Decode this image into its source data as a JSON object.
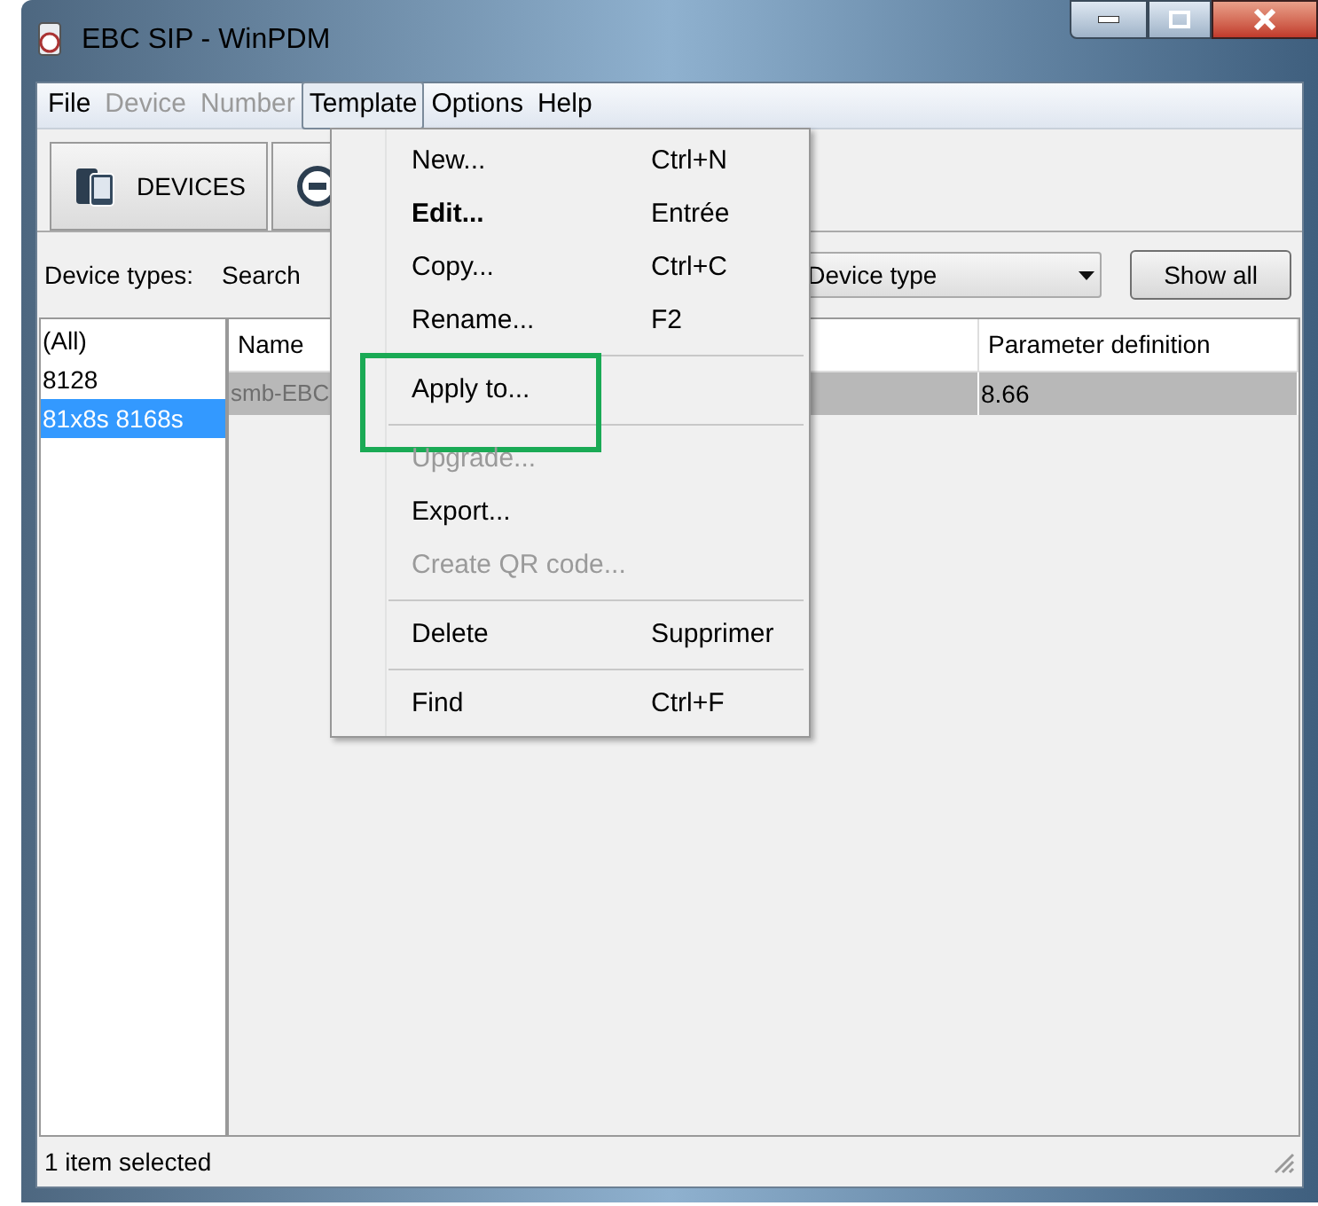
{
  "window": {
    "title": "EBC SIP - WinPDM"
  },
  "menubar": [
    {
      "label": "File",
      "disabled": false,
      "selected": false
    },
    {
      "label": "Device",
      "disabled": true,
      "selected": false
    },
    {
      "label": "Number",
      "disabled": true,
      "selected": false
    },
    {
      "label": "Template",
      "disabled": false,
      "selected": true
    },
    {
      "label": "Options",
      "disabled": false,
      "selected": false
    },
    {
      "label": "Help",
      "disabled": false,
      "selected": false
    }
  ],
  "tabs": [
    {
      "label": "DEVICES",
      "kind": "devices"
    },
    {
      "kind": "numbers"
    }
  ],
  "filter": {
    "label": "Device types:",
    "search_label": "Search",
    "dropdown": "Device type",
    "button": "Show all"
  },
  "device_types": [
    {
      "label": "(All)",
      "selected": false
    },
    {
      "label": "8128",
      "selected": false
    },
    {
      "label": "81x8s 8168s",
      "selected": true
    }
  ],
  "table": {
    "columns": [
      "Name",
      "Parameter definition"
    ],
    "rows": [
      {
        "cells": [
          "smb-EBC",
          "8.66"
        ],
        "selected": true
      }
    ]
  },
  "menu": [
    {
      "kind": "item",
      "label": "New...",
      "shortcut": "Ctrl+N",
      "bold": false,
      "disabled": false,
      "highlighted": false
    },
    {
      "kind": "item",
      "label": "Edit...",
      "shortcut": "Entrée",
      "bold": true,
      "disabled": false,
      "highlighted": false
    },
    {
      "kind": "item",
      "label": "Copy...",
      "shortcut": "Ctrl+C",
      "bold": false,
      "disabled": false,
      "highlighted": false
    },
    {
      "kind": "item",
      "label": "Rename...",
      "shortcut": "F2",
      "bold": false,
      "disabled": false,
      "highlighted": false
    },
    {
      "kind": "separator"
    },
    {
      "kind": "item",
      "label": "Apply to...",
      "bold": false,
      "disabled": false,
      "highlighted": true
    },
    {
      "kind": "separator"
    },
    {
      "kind": "item",
      "label": "Upgrade...",
      "bold": false,
      "disabled": true,
      "highlighted": false
    },
    {
      "kind": "item",
      "label": "Export...",
      "bold": false,
      "disabled": false,
      "highlighted": false
    },
    {
      "kind": "item",
      "label": "Create QR code...",
      "bold": false,
      "disabled": true,
      "highlighted": false
    },
    {
      "kind": "separator"
    },
    {
      "kind": "item",
      "label": "Delete",
      "shortcut": "Supprimer",
      "bold": false,
      "disabled": false,
      "highlighted": false
    },
    {
      "kind": "separator"
    },
    {
      "kind": "item",
      "label": "Find",
      "shortcut": "Ctrl+F",
      "bold": false,
      "disabled": false,
      "highlighted": false
    }
  ],
  "status_bar": "1 item selected"
}
